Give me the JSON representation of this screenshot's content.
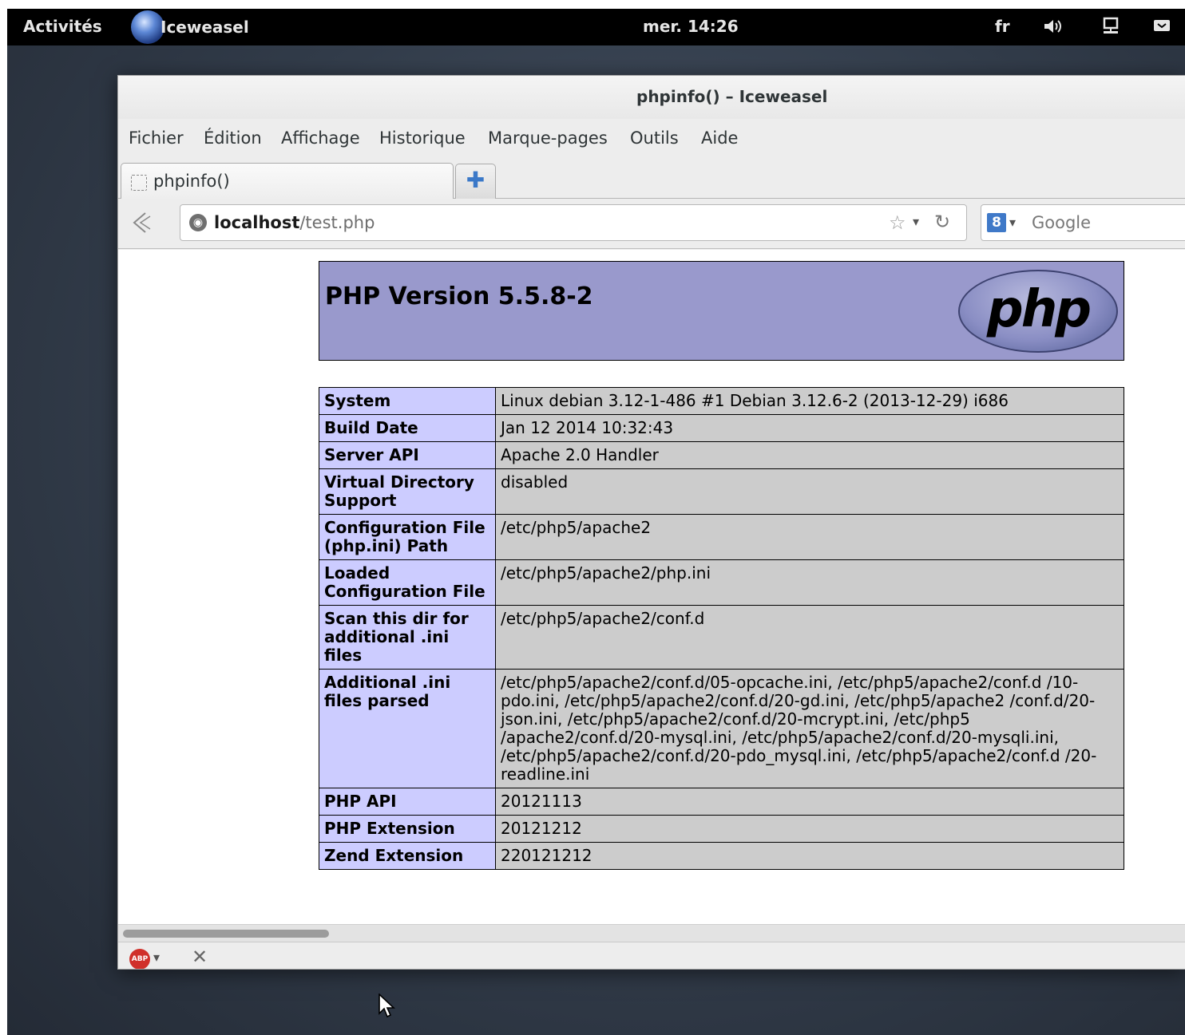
{
  "topbar": {
    "activities": "Activités",
    "app_name": "Iceweasel",
    "clock": "mer. 14:26",
    "keyboard_layout": "fr",
    "icons": [
      "volume-icon",
      "network-icon",
      "chat-icon"
    ]
  },
  "window": {
    "title": "phpinfo() – Iceweasel",
    "menu": [
      "Fichier",
      "Édition",
      "Affichage",
      "Historique",
      "Marque-pages",
      "Outils",
      "Aide"
    ],
    "tab": {
      "label": "phpinfo()"
    },
    "url": {
      "host": "localhost",
      "path": "/test.php"
    },
    "search": {
      "engine": "8",
      "placeholder": "Google"
    }
  },
  "php": {
    "version": "PHP Version 5.5.8-2",
    "logo": "php",
    "rows": [
      {
        "key": "System",
        "value": "Linux debian 3.12-1-486 #1 Debian 3.12.6-2 (2013-12-29) i686"
      },
      {
        "key": "Build Date",
        "value": "Jan 12 2014 10:32:43"
      },
      {
        "key": "Server API",
        "value": "Apache 2.0 Handler"
      },
      {
        "key": "Virtual Directory Support",
        "value": "disabled"
      },
      {
        "key": "Configuration File (php.ini) Path",
        "value": "/etc/php5/apache2"
      },
      {
        "key": "Loaded Configuration File",
        "value": "/etc/php5/apache2/php.ini"
      },
      {
        "key": "Scan this dir for additional .ini files",
        "value": "/etc/php5/apache2/conf.d"
      },
      {
        "key": "Additional .ini files parsed",
        "value": "/etc/php5/apache2/conf.d/05-opcache.ini, /etc/php5/apache2/conf.d /10-pdo.ini, /etc/php5/apache2/conf.d/20-gd.ini, /etc/php5/apache2 /conf.d/20-json.ini, /etc/php5/apache2/conf.d/20-mcrypt.ini, /etc/php5 /apache2/conf.d/20-mysql.ini, /etc/php5/apache2/conf.d/20-mysqli.ini, /etc/php5/apache2/conf.d/20-pdo_mysql.ini, /etc/php5/apache2/conf.d /20-readline.ini"
      },
      {
        "key": "PHP API",
        "value": "20121113"
      },
      {
        "key": "PHP Extension",
        "value": "20121212"
      },
      {
        "key": "Zend Extension",
        "value": "220121212"
      }
    ]
  },
  "addonbar": {
    "abp_label": "ABP"
  }
}
